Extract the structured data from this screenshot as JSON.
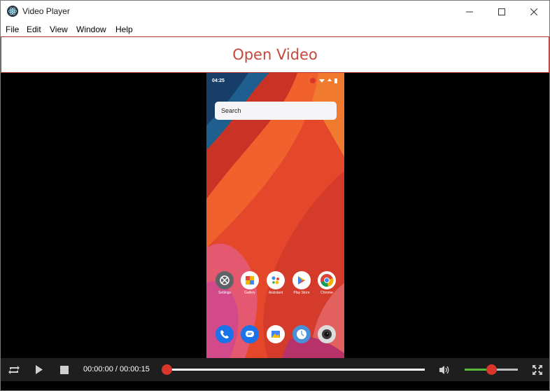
{
  "window": {
    "title": "Video Player",
    "icons": {
      "app": "electron-atom-icon",
      "minimize": "minimize-icon",
      "maximize": "maximize-icon",
      "close": "close-icon"
    }
  },
  "menu": {
    "items": [
      {
        "label": "File"
      },
      {
        "label": "Edit"
      },
      {
        "label": "View"
      },
      {
        "label": "Window"
      },
      {
        "label": "Help"
      }
    ]
  },
  "open_bar": {
    "label": "Open Video",
    "accent_color": "#c6473c"
  },
  "video_frame": {
    "status_time": "04:25",
    "search_label": "Search",
    "home_apps": [
      {
        "name": "settings-icon",
        "label": "Settings"
      },
      {
        "name": "gallery-icon",
        "label": "Gallery"
      },
      {
        "name": "assistant-icon",
        "label": "Assistant"
      },
      {
        "name": "play-store-icon",
        "label": "Play Store"
      },
      {
        "name": "chrome-icon",
        "label": "Chrome"
      }
    ],
    "dock_apps": [
      {
        "name": "phone-icon"
      },
      {
        "name": "messages-icon"
      },
      {
        "name": "photos-icon"
      },
      {
        "name": "clock-icon"
      },
      {
        "name": "camera-icon"
      }
    ]
  },
  "controls": {
    "time_display": "00:00:00 / 00:00:15",
    "position_fraction": 0.0,
    "volume_fraction": 0.5,
    "icons": {
      "loop": "loop-icon",
      "play": "play-icon",
      "stop": "stop-icon",
      "volume": "volume-icon",
      "fullscreen": "fullscreen-icon"
    },
    "colors": {
      "knob": "#d9352b",
      "volume_fill": "#57b83a",
      "bar_bg": "#1e1e1e"
    }
  }
}
